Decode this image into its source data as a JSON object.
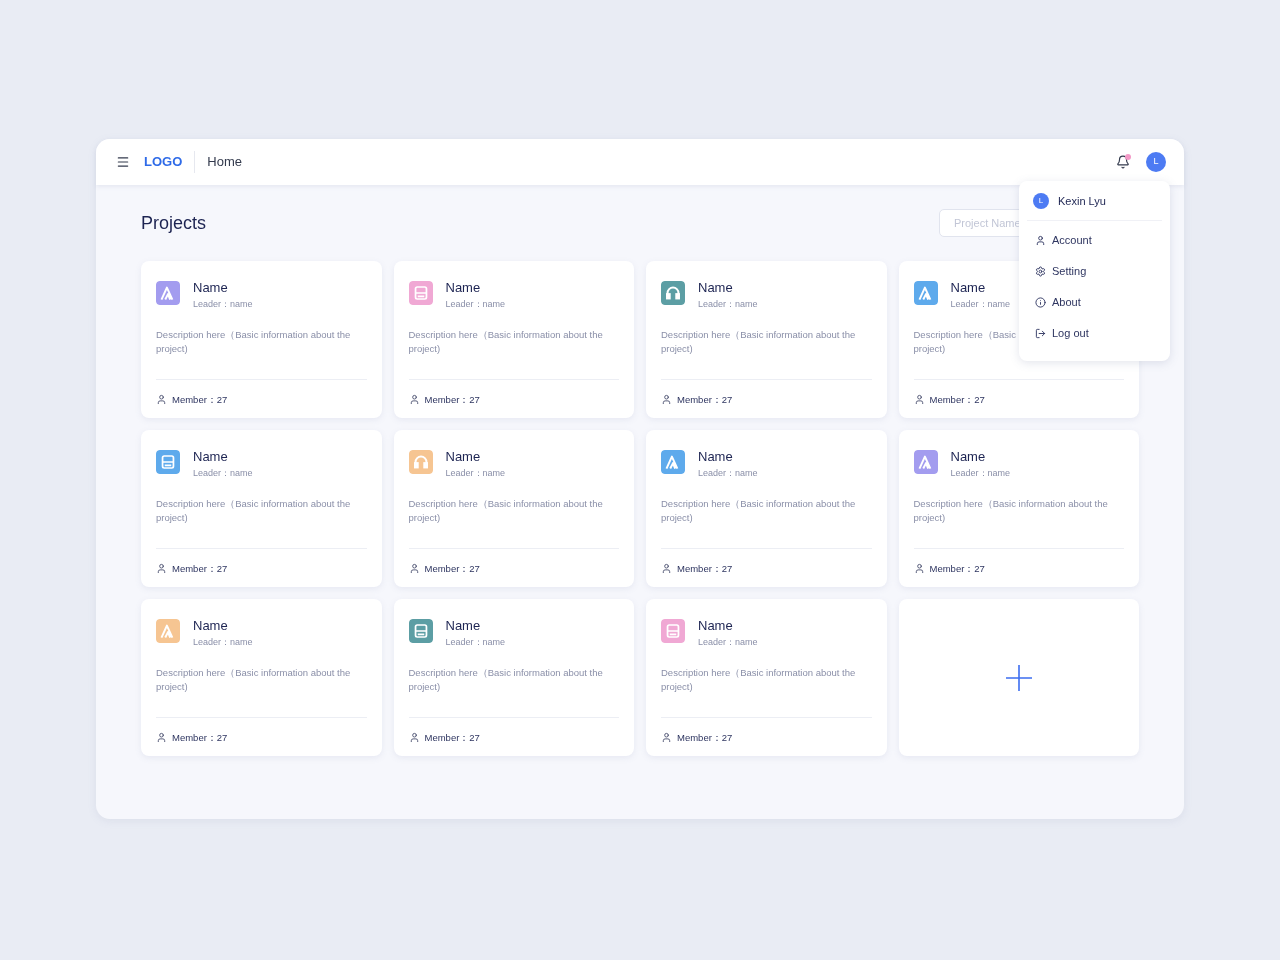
{
  "header": {
    "logo": "LOGO",
    "breadcrumb": "Home",
    "notification_dot": true,
    "avatar_initial": "L"
  },
  "page_title": "Projects",
  "search": {
    "placeholder": "Project Name"
  },
  "cards": [
    {
      "kind": "mountain",
      "color": "#a39cef",
      "name": "Name",
      "leader": "Leader：name",
      "description_lines": [
        "Description here（Basic information about the",
        "project)"
      ],
      "members": "Member：27"
    },
    {
      "kind": "book",
      "color": "#f0a8d4",
      "name": "Name",
      "leader": "Leader：name",
      "description_lines": [
        "Description here（Basic information about the",
        "project)"
      ],
      "members": "Member：27"
    },
    {
      "kind": "headphones",
      "color": "#5c9ea4",
      "name": "Name",
      "leader": "Leader：name",
      "description_lines": [
        "Description here（Basic information about the",
        "project)"
      ],
      "members": "Member：27"
    },
    {
      "kind": "mountain",
      "color": "#5eaaec",
      "name": "Name",
      "leader": "Leader：name",
      "description_lines": [
        "Description here（Basic",
        "project)"
      ],
      "members": "Member：27"
    },
    {
      "kind": "book",
      "color": "#5eaaec",
      "name": "Name",
      "leader": "Leader：name",
      "description_lines": [
        "Description here（Basic information about the",
        "project)"
      ],
      "members": "Member：27"
    },
    {
      "kind": "headphones",
      "color": "#f6c592",
      "name": "Name",
      "leader": "Leader：name",
      "description_lines": [
        "Description here（Basic information about the",
        "project)"
      ],
      "members": "Member：27"
    },
    {
      "kind": "mountain",
      "color": "#5eaaec",
      "name": "Name",
      "leader": "Leader：name",
      "description_lines": [
        "Description here（Basic information about the",
        "project)"
      ],
      "members": "Member：27"
    },
    {
      "kind": "mountain",
      "color": "#a39cef",
      "name": "Name",
      "leader": "Leader：name",
      "description_lines": [
        "Description here（Basic information about the",
        "project)"
      ],
      "members": "Member：27"
    },
    {
      "kind": "mountain",
      "color": "#f6c592",
      "name": "Name",
      "leader": "Leader：name",
      "description_lines": [
        "Description here（Basic information about the",
        "project)"
      ],
      "members": "Member：27"
    },
    {
      "kind": "book",
      "color": "#5c9ea4",
      "name": "Name",
      "leader": "Leader：name",
      "description_lines": [
        "Description here（Basic information about the",
        "project)"
      ],
      "members": "Member：27"
    },
    {
      "kind": "book",
      "color": "#f0a8d4",
      "name": "Name",
      "leader": "Leader：name",
      "description_lines": [
        "Description here（Basic information about the",
        "project)"
      ],
      "members": "Member：27"
    },
    {
      "kind": "add"
    }
  ],
  "user_menu": {
    "avatar_initial": "L",
    "user_name": "Kexin Lyu",
    "items": [
      {
        "kind": "user",
        "label": "Account"
      },
      {
        "kind": "gear",
        "label": "Setting"
      },
      {
        "kind": "info",
        "label": "About"
      },
      {
        "kind": "logout",
        "label": "Log out"
      }
    ]
  }
}
